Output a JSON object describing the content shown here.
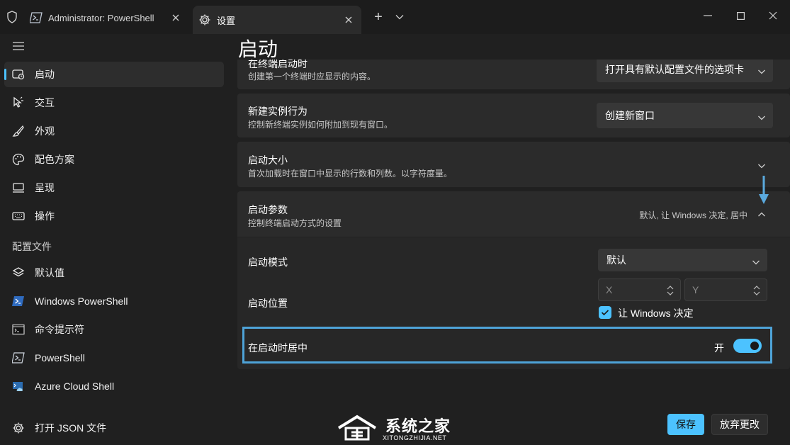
{
  "titlebar": {
    "tabs": [
      {
        "label": "Administrator: PowerShell",
        "icon": "powershell-icon"
      },
      {
        "label": "设置",
        "icon": "gear-icon"
      }
    ],
    "new_tab_symbol": "+"
  },
  "sidebar": {
    "items": [
      {
        "label": "启动",
        "icon": "startup-icon"
      },
      {
        "label": "交互",
        "icon": "cursor-icon"
      },
      {
        "label": "外观",
        "icon": "brush-icon"
      },
      {
        "label": "配色方案",
        "icon": "palette-icon"
      },
      {
        "label": "呈现",
        "icon": "monitor-icon"
      },
      {
        "label": "操作",
        "icon": "keyboard-icon"
      }
    ],
    "profiles_header": "配置文件",
    "profiles": [
      {
        "label": "默认值",
        "icon": "layers-icon"
      },
      {
        "label": "Windows PowerShell",
        "icon": "powershell-icon"
      },
      {
        "label": "命令提示符",
        "icon": "cmd-icon"
      },
      {
        "label": "PowerShell",
        "icon": "powershell-icon"
      },
      {
        "label": "Azure Cloud Shell",
        "icon": "azure-icon"
      }
    ],
    "open_json": "打开 JSON 文件"
  },
  "main": {
    "title": "启动",
    "cards": {
      "on_launch": {
        "title": "在终端启动时",
        "desc": "创建第一个终端时应显示的内容。",
        "value": "打开具有默认配置文件的选项卡"
      },
      "new_instance": {
        "title": "新建实例行为",
        "desc": "控制新终端实例如何附加到现有窗口。",
        "value": "创建新窗口"
      },
      "launch_size": {
        "title": "启动大小",
        "desc": "首次加载时在窗口中显示的行数和列数。以字符度量。"
      },
      "launch_params": {
        "title": "启动参数",
        "desc": "控制终端启动方式的设置",
        "summary": "默认, 让 Windows 决定, 居中"
      }
    },
    "launch_mode": {
      "label": "启动模式",
      "value": "默认"
    },
    "launch_position": {
      "label": "启动位置",
      "x_placeholder": "X",
      "y_placeholder": "Y",
      "checkbox_label": "让 Windows 决定",
      "checked": true
    },
    "center_on_launch": {
      "label": "在启动时居中",
      "state_label": "开",
      "on": true
    }
  },
  "footer": {
    "save": "保存",
    "discard": "放弃更改"
  },
  "watermark": {
    "text": "系统之家",
    "url": "XITONGZHIJIA.NET"
  },
  "colors": {
    "accent": "#4cc2ff",
    "highlight_border": "#4ea3d8"
  }
}
